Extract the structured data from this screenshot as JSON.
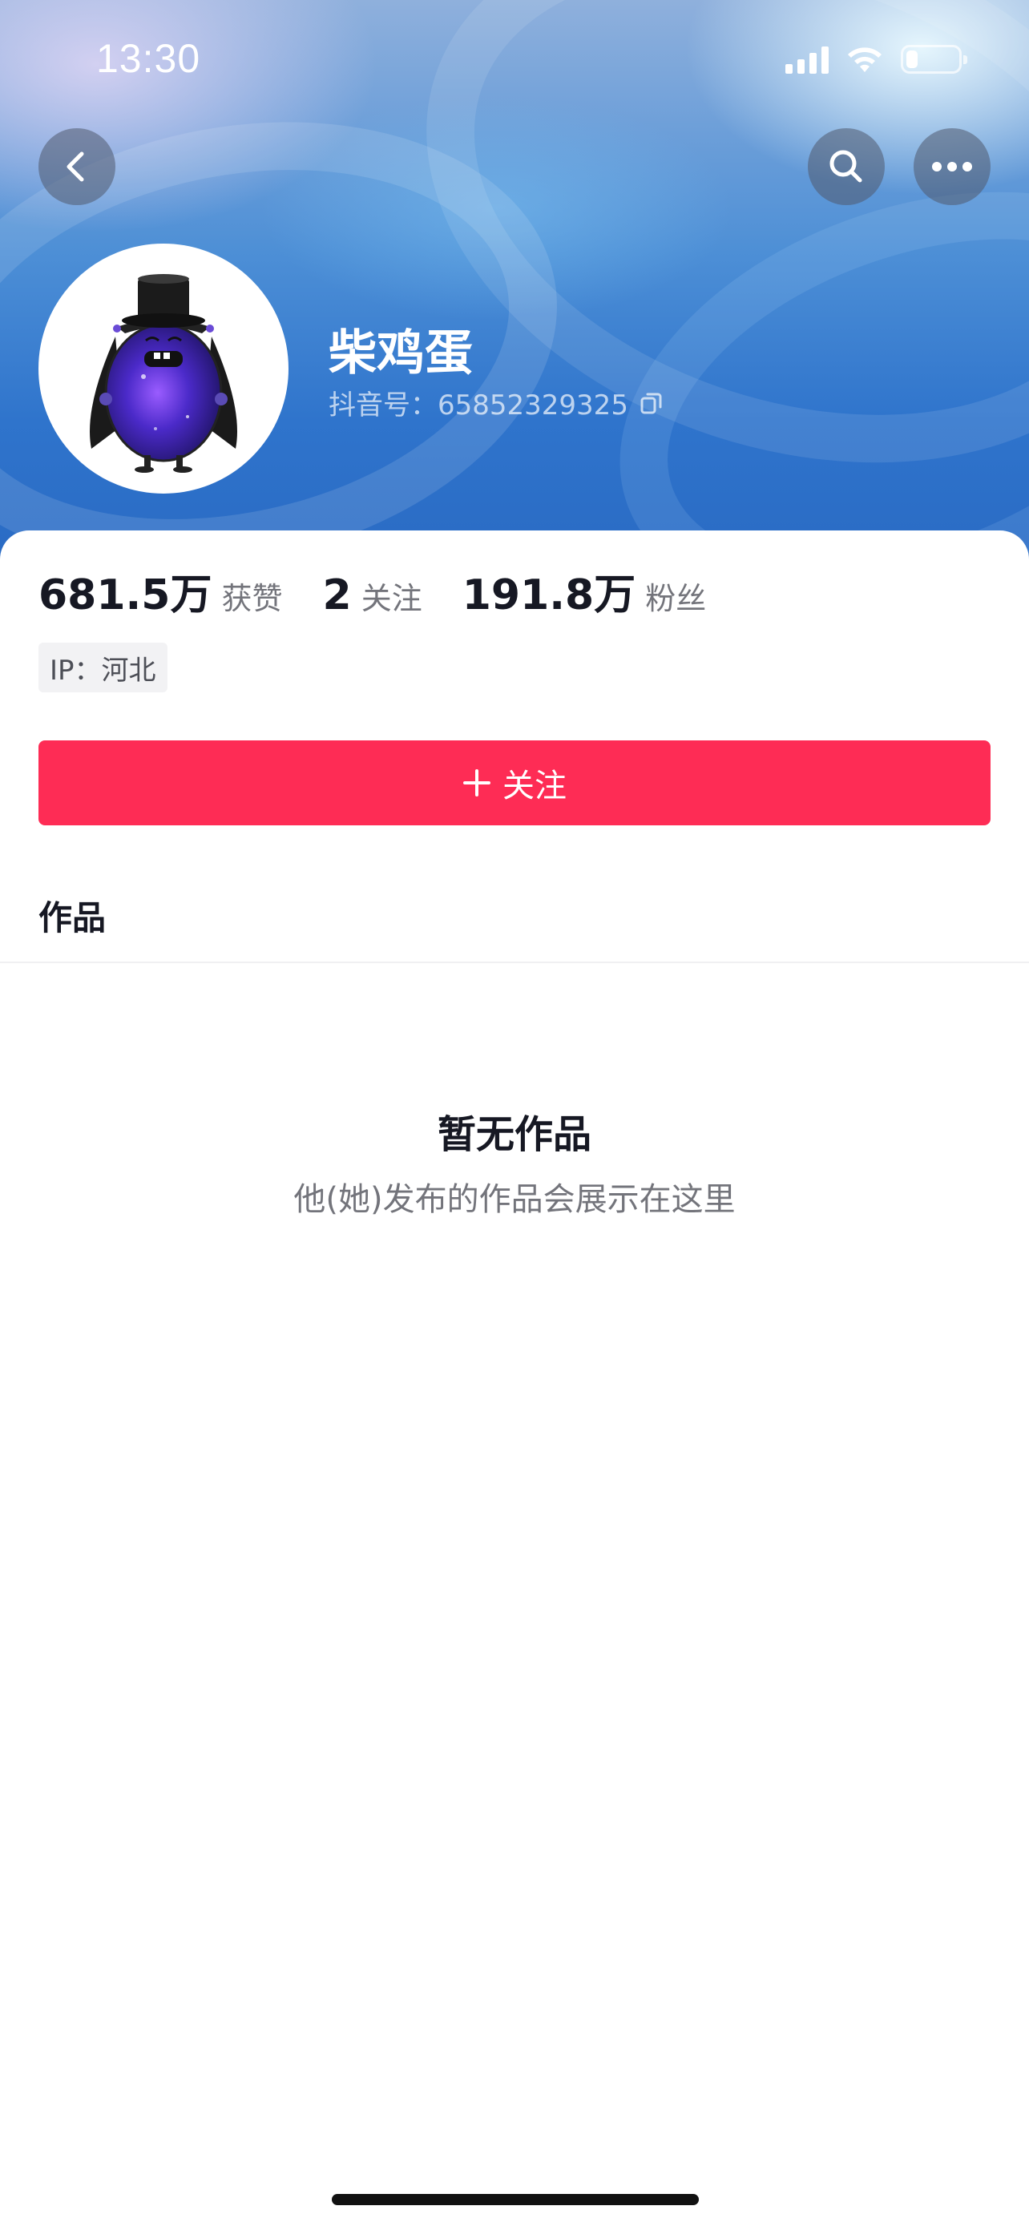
{
  "status_bar": {
    "time": "13:30",
    "battery_level": 0.2
  },
  "header": {
    "back_icon": "chevron-left-icon",
    "search_icon": "search-icon",
    "more_icon": "more-horizontal-icon"
  },
  "profile": {
    "nickname": "柴鸡蛋",
    "douyin_id_label": "抖音号：",
    "douyin_id": "65852329325",
    "copy_icon": "copy-icon"
  },
  "stats": [
    {
      "value": "681.5万",
      "label": "获赞"
    },
    {
      "value": "2",
      "label": "关注"
    },
    {
      "value": "191.8万",
      "label": "粉丝"
    }
  ],
  "ip_tag": "IP：河北",
  "follow_button": {
    "icon": "plus-icon",
    "label": "关注"
  },
  "tabs": {
    "works": "作品"
  },
  "empty_state": {
    "title": "暂无作品",
    "subtitle": "他(她)发布的作品会展示在这里"
  },
  "colors": {
    "accent": "#fe2c55",
    "text_primary": "#161823"
  }
}
